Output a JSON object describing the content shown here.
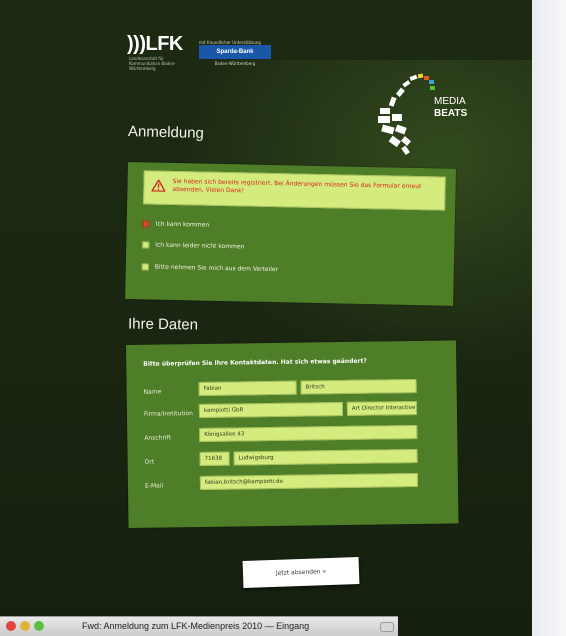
{
  "logos": {
    "lfk_text": ")))LFK",
    "lfk_sub": "Landesanstalt für Kommunikation Baden-Württemberg",
    "bank_caption": "mit freundlicher Unterstützung",
    "bank_name": "Sparda-Bank",
    "bank_sub": "Baden-Württemberg",
    "event_line1": "MEDIA",
    "event_line2": "BEATS"
  },
  "registration": {
    "heading": "Anmeldung",
    "warning": "Sie haben sich bereits registriert. Bei Änderungen müssen Sie das Formular erneut absenden, Vielen Dank!",
    "options": [
      {
        "label": "Ich kann kommen",
        "checked": true
      },
      {
        "label": "Ich kann leider nicht kommen",
        "checked": false
      },
      {
        "label": "Bitte nehmen Sie mich aus dem Verteiler",
        "checked": false
      }
    ]
  },
  "details": {
    "heading": "Ihre Daten",
    "intro": "Bitte überprüfen Sie Ihre Kontaktdaten. Hat sich etwas geändert?",
    "labels": {
      "name": "Name",
      "company": "Firma/Institution",
      "address": "Anschrift",
      "city": "Ort",
      "email": "E-Mail"
    },
    "values": {
      "first_name": "Fabian",
      "last_name": "Britsch",
      "company": "kampiotti GbR",
      "position": "Art Director Interactive",
      "street": "Königsallee 43",
      "zip": "71638",
      "city": "Ludwigsburg",
      "email": "fabian.britsch@kampiotti.de"
    }
  },
  "submit_label": "Jetzt absenden »",
  "window": {
    "title": "Fwd: Anmeldung zum LFK-Medienpreis 2010 — Eingang"
  },
  "colors": {
    "page_bg": "#1a2611",
    "panel": "#4f7e28",
    "field": "#d4eb7e",
    "warning_text": "#d3271d"
  }
}
